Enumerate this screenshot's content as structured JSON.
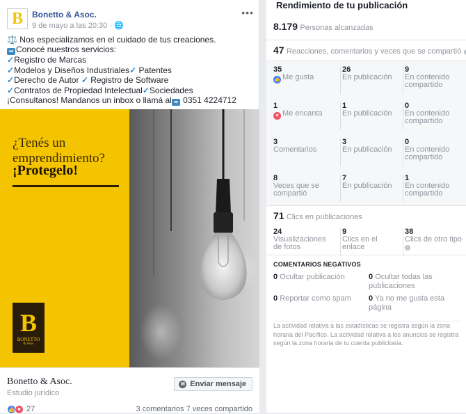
{
  "post": {
    "page_name": "Bonetto & Asoc.",
    "avatar_letter": "B",
    "date": "9 de mayo a las 20:30 · ",
    "lines": [
      "⚖️ Nos especializamos en el cuidado de tus creaciones.",
      "Conocé nuestros servicios:",
      "Registro de Marcas",
      "Modelos y Diseños Industriales",
      "Patentes",
      "Derecho de Autor",
      "Registro de Software",
      "Contratos de Propiedad Intelectual",
      "Sociedades",
      "¡Consultanos! Mandanos un inbox o llamá al",
      "0351 4224712"
    ]
  },
  "ad": {
    "line1": "¿Tenés un emprendimiento?",
    "line2": "¡Protegelo!",
    "logo_letter": "B",
    "logo_text": "BONETTO",
    "logo_sub": "& Asoc"
  },
  "footer": {
    "name": "Bonetto & Asoc.",
    "type": "Estudio jurídico",
    "button": "Enviar mensaje",
    "reactions_count": "27",
    "stats": "3 comentarios  7 veces compartido"
  },
  "panel": {
    "title": "Rendimiento de tu publicación",
    "reach_value": "8.179",
    "reach_label": "Personas alcanzadas",
    "engagement_value": "47",
    "engagement_label": "Reacciones, comentarios y veces que se compartió",
    "grid": [
      {
        "c1n": "35",
        "c1l": "Me gusta",
        "c2n": "26",
        "c2l": "En publicación",
        "c3n": "9",
        "c3l": "En contenido compartido"
      },
      {
        "c1n": "1",
        "c1l": "Me encanta",
        "c2n": "1",
        "c2l": "En publicación",
        "c3n": "0",
        "c3l": "En contenido compartido"
      },
      {
        "c1n": "3",
        "c1l": "Comentarios",
        "c2n": "3",
        "c2l": "En publicación",
        "c3n": "0",
        "c3l": "En contenido compartido"
      },
      {
        "c1n": "8",
        "c1l": "Veces que se compartió",
        "c2n": "7",
        "c2l": "En publicación",
        "c3n": "1",
        "c3l": "En contenido compartido"
      }
    ],
    "clicks_value": "71",
    "clicks_label": "Clics en publicaciones",
    "clicks": [
      {
        "n": "24",
        "l": "Visualizaciones de fotos"
      },
      {
        "n": "9",
        "l": "Clics en el enlace"
      },
      {
        "n": "38",
        "l": "Clics de otro tipo"
      }
    ],
    "neg_title": "COMENTARIOS NEGATIVOS",
    "neg": [
      {
        "n": "0",
        "l": "Ocultar publicación"
      },
      {
        "n": "0",
        "l": "Ocultar todas las publicaciones"
      },
      {
        "n": "0",
        "l": "Reportar como spam"
      },
      {
        "n": "0",
        "l": "Ya no me gusta esta página"
      }
    ],
    "note": "La actividad relativa a las estadísticas se registra según la zona horaria del Pacífico. La actividad relativa a los anuncios se registra según la zona horaria de tu cuenta publicitaria."
  }
}
